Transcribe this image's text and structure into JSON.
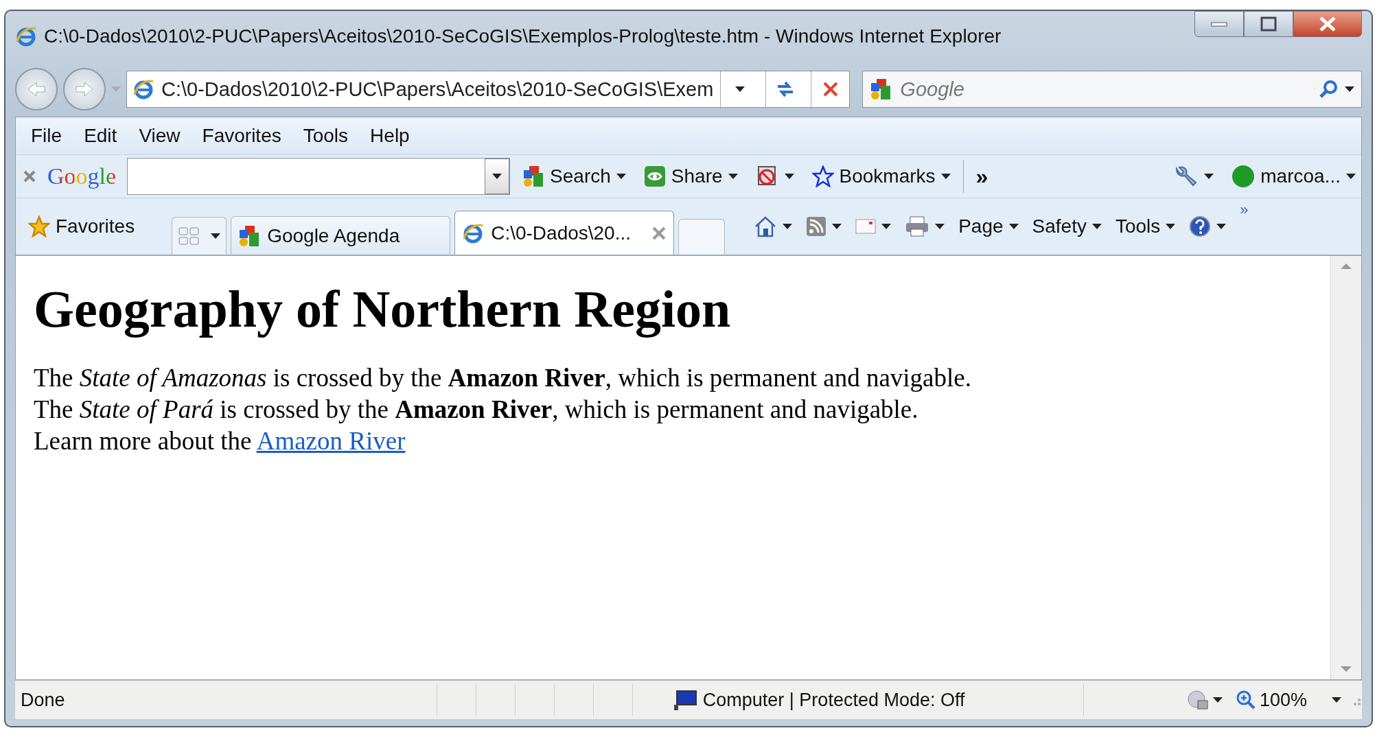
{
  "window": {
    "title": "C:\\0-Dados\\2010\\2-PUC\\Papers\\Aceitos\\2010-SeCoGIS\\Exemplos-Prolog\\teste.htm - Windows Internet Explorer"
  },
  "address_bar": {
    "value": "C:\\0-Dados\\2010\\2-PUC\\Papers\\Aceitos\\2010-SeCoGIS\\Exem"
  },
  "search_box": {
    "placeholder": "Google"
  },
  "menu_bar": [
    "File",
    "Edit",
    "View",
    "Favorites",
    "Tools",
    "Help"
  ],
  "google_toolbar": {
    "logo": "Google",
    "buttons": [
      {
        "kind": "search",
        "label": "Search"
      },
      {
        "kind": "share",
        "label": "Share"
      },
      {
        "kind": "popup"
      },
      {
        "kind": "bookmarks",
        "label": "Bookmarks"
      },
      {
        "kind": "more",
        "label": "»"
      },
      {
        "kind": "wrench"
      },
      {
        "kind": "account",
        "label": "marcoa..."
      }
    ]
  },
  "favorites": {
    "label": "Favorites"
  },
  "tabs": [
    {
      "label": "Google Agenda",
      "kind": "google",
      "selected": false
    },
    {
      "label": "C:\\0-Dados\\20...",
      "kind": "ie",
      "selected": true
    }
  ],
  "command_bar": [
    {
      "kind": "home"
    },
    {
      "kind": "feeds"
    },
    {
      "kind": "mail"
    },
    {
      "kind": "print"
    },
    {
      "kind": "menu",
      "label": "Page"
    },
    {
      "kind": "menu",
      "label": "Safety"
    },
    {
      "kind": "menu",
      "label": "Tools"
    },
    {
      "kind": "help"
    }
  ],
  "command_more": "»",
  "page": {
    "heading": "Geography of Northern Region",
    "lines": [
      {
        "text": "The *State of Amazonas* is crossed by the **Amazon River**, which is permanent and navigable."
      },
      {
        "text": "The *State of Pará* is crossed by the **Amazon River**, which is permanent and navigable."
      },
      {
        "text": "Learn more about the ",
        "link": "Amazon River"
      }
    ]
  },
  "status_bar": {
    "status": "Done",
    "zone": "Computer | Protected Mode: Off",
    "zoom": "100%"
  }
}
